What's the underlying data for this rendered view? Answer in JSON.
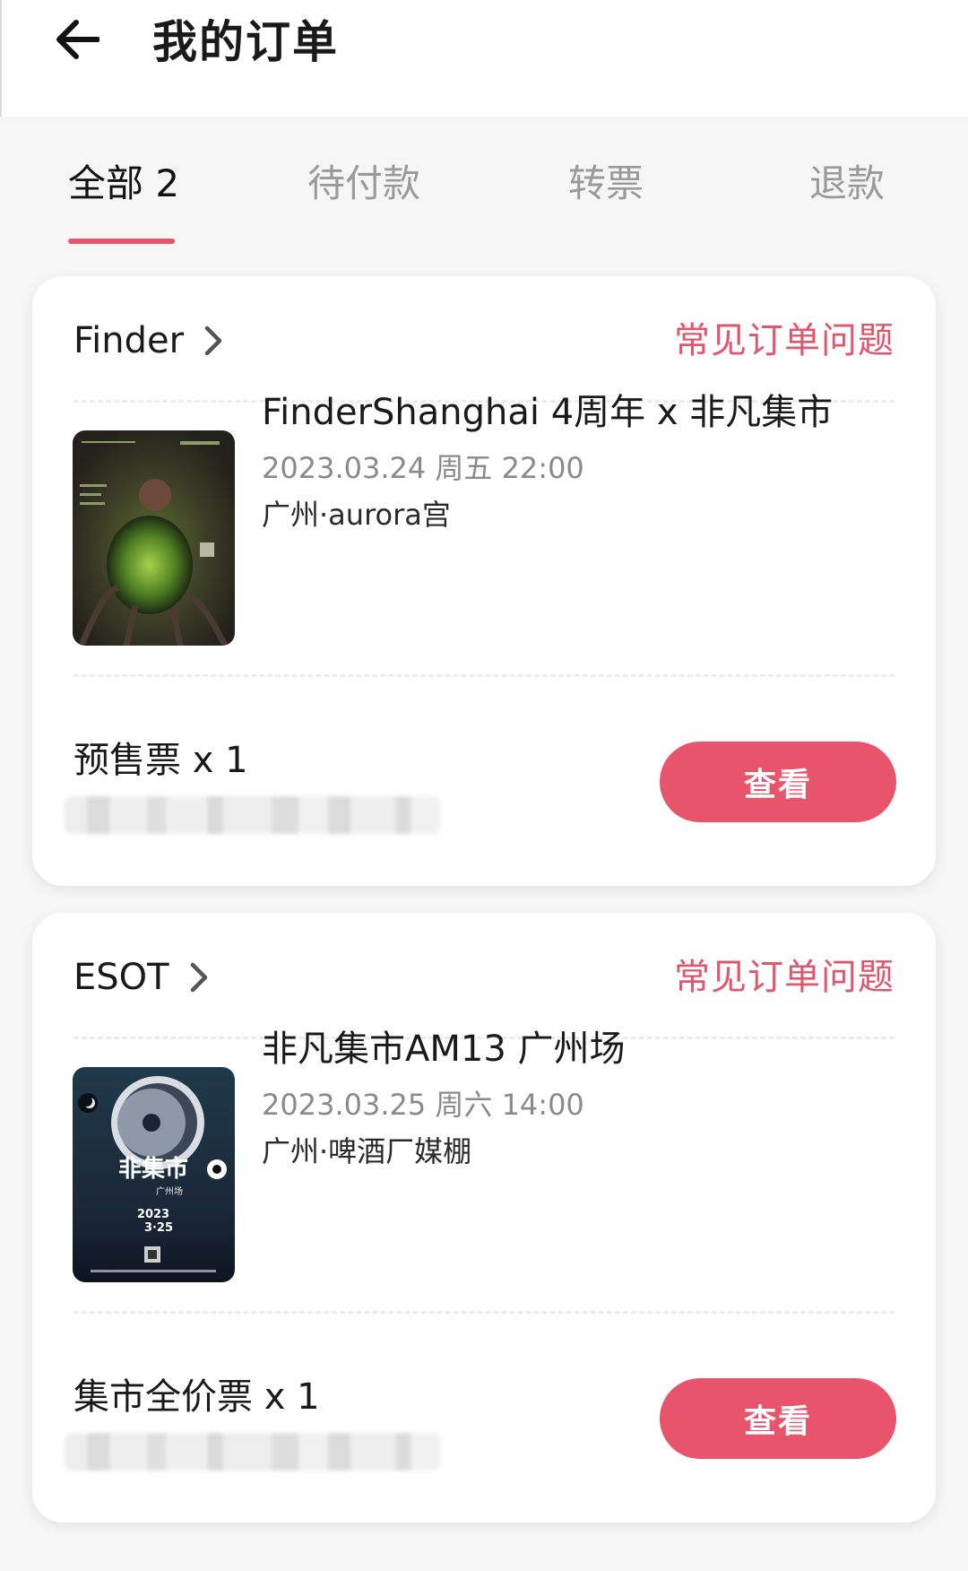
{
  "header": {
    "title": "我的订单"
  },
  "tabs": [
    {
      "label": "全部 2",
      "active": true
    },
    {
      "label": "待付款",
      "active": false
    },
    {
      "label": "转票",
      "active": false
    },
    {
      "label": "退款",
      "active": false
    }
  ],
  "orders": [
    {
      "organizer": "Finder",
      "faq_label": "常见订单问题",
      "event_title": "FinderShanghai 4周年 x 非凡集市",
      "event_date": "2023.03.24 周五 22:00",
      "event_venue": "广州·aurora宫",
      "ticket": "预售票 x 1",
      "button_label": "查看"
    },
    {
      "organizer": "ESOT",
      "faq_label": "常见订单问题",
      "event_title": "非凡集市AM13 广州场",
      "event_date": "2023.03.25 周六 14:00",
      "event_venue": "广州·啤酒厂媒棚",
      "ticket": "集市全价票 x 1",
      "button_label": "查看",
      "poster_text": {
        "title": "非集市",
        "subtitle": "广州场",
        "year": "2023",
        "date": "3·25"
      }
    }
  ],
  "colors": {
    "accent": "#e8546b",
    "faq_link": "#e0566c",
    "tab_inactive": "#9a9a9a",
    "background": "#f6f6f7"
  },
  "icons": {
    "back": "arrow-left-icon",
    "organizer_link": "chevron-right-icon"
  }
}
